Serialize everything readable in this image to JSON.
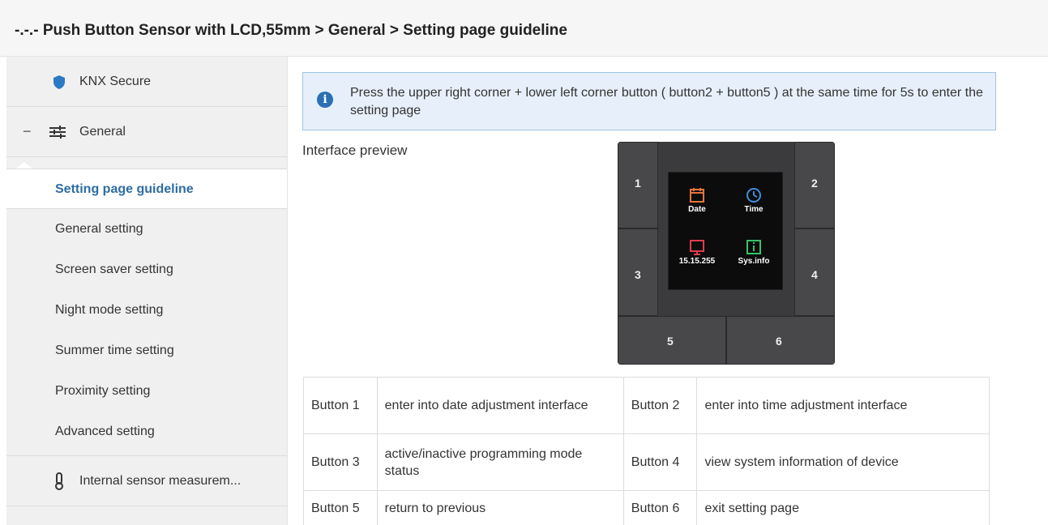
{
  "header": {
    "breadcrumb": "-.-.- Push Button Sensor with LCD,55mm > General > Setting page guideline"
  },
  "sidebar": {
    "knx_secure": {
      "label": "KNX Secure",
      "icon": "shield-icon"
    },
    "general": {
      "label": "General",
      "icon": "sliders-icon",
      "collapse": "−"
    },
    "items": [
      {
        "label": "Setting page guideline",
        "active": true
      },
      {
        "label": "General setting"
      },
      {
        "label": "Screen saver setting"
      },
      {
        "label": "Night mode setting"
      },
      {
        "label": "Summer time setting"
      },
      {
        "label": "Proximity setting"
      },
      {
        "label": "Advanced setting"
      }
    ],
    "internal_sensor": {
      "label": "Internal sensor measurem...",
      "icon": "thermometer-icon"
    }
  },
  "info": {
    "icon": "info-icon",
    "icon_glyph": "i",
    "text": "Press the upper right corner + lower left corner button ( button2 + button5 ) at the same time for 5s to enter the setting page"
  },
  "preview": {
    "label": "Interface preview",
    "buttons": [
      "1",
      "2",
      "3",
      "4",
      "5",
      "6"
    ],
    "tiles": [
      {
        "label": "Date",
        "icon": "calendar-icon",
        "color": "#e8743b"
      },
      {
        "label": "Time",
        "icon": "clock-icon",
        "color": "#3d8fe0"
      },
      {
        "label": "15.15.255",
        "icon": "ets-icon",
        "color": "#e03d4f"
      },
      {
        "label": "Sys.info",
        "icon": "info-box-icon",
        "color": "#38c26a"
      }
    ]
  },
  "table": [
    {
      "k1": "Button 1",
      "v1": "enter into date adjustment interface",
      "k2": "Button 2",
      "v2": "enter into time adjustment interface"
    },
    {
      "k1": "Button 3",
      "v1": "active/inactive programming mode status",
      "k2": "Button 4",
      "v2": "view system information of device"
    },
    {
      "k1": "Button 5",
      "v1": "return to previous",
      "k2": "Button 6",
      "v2": "exit setting page"
    }
  ],
  "colors": {
    "accent": "#2d6da3",
    "info_bg": "#e7f0fa",
    "info_border": "#9fc2e3"
  }
}
